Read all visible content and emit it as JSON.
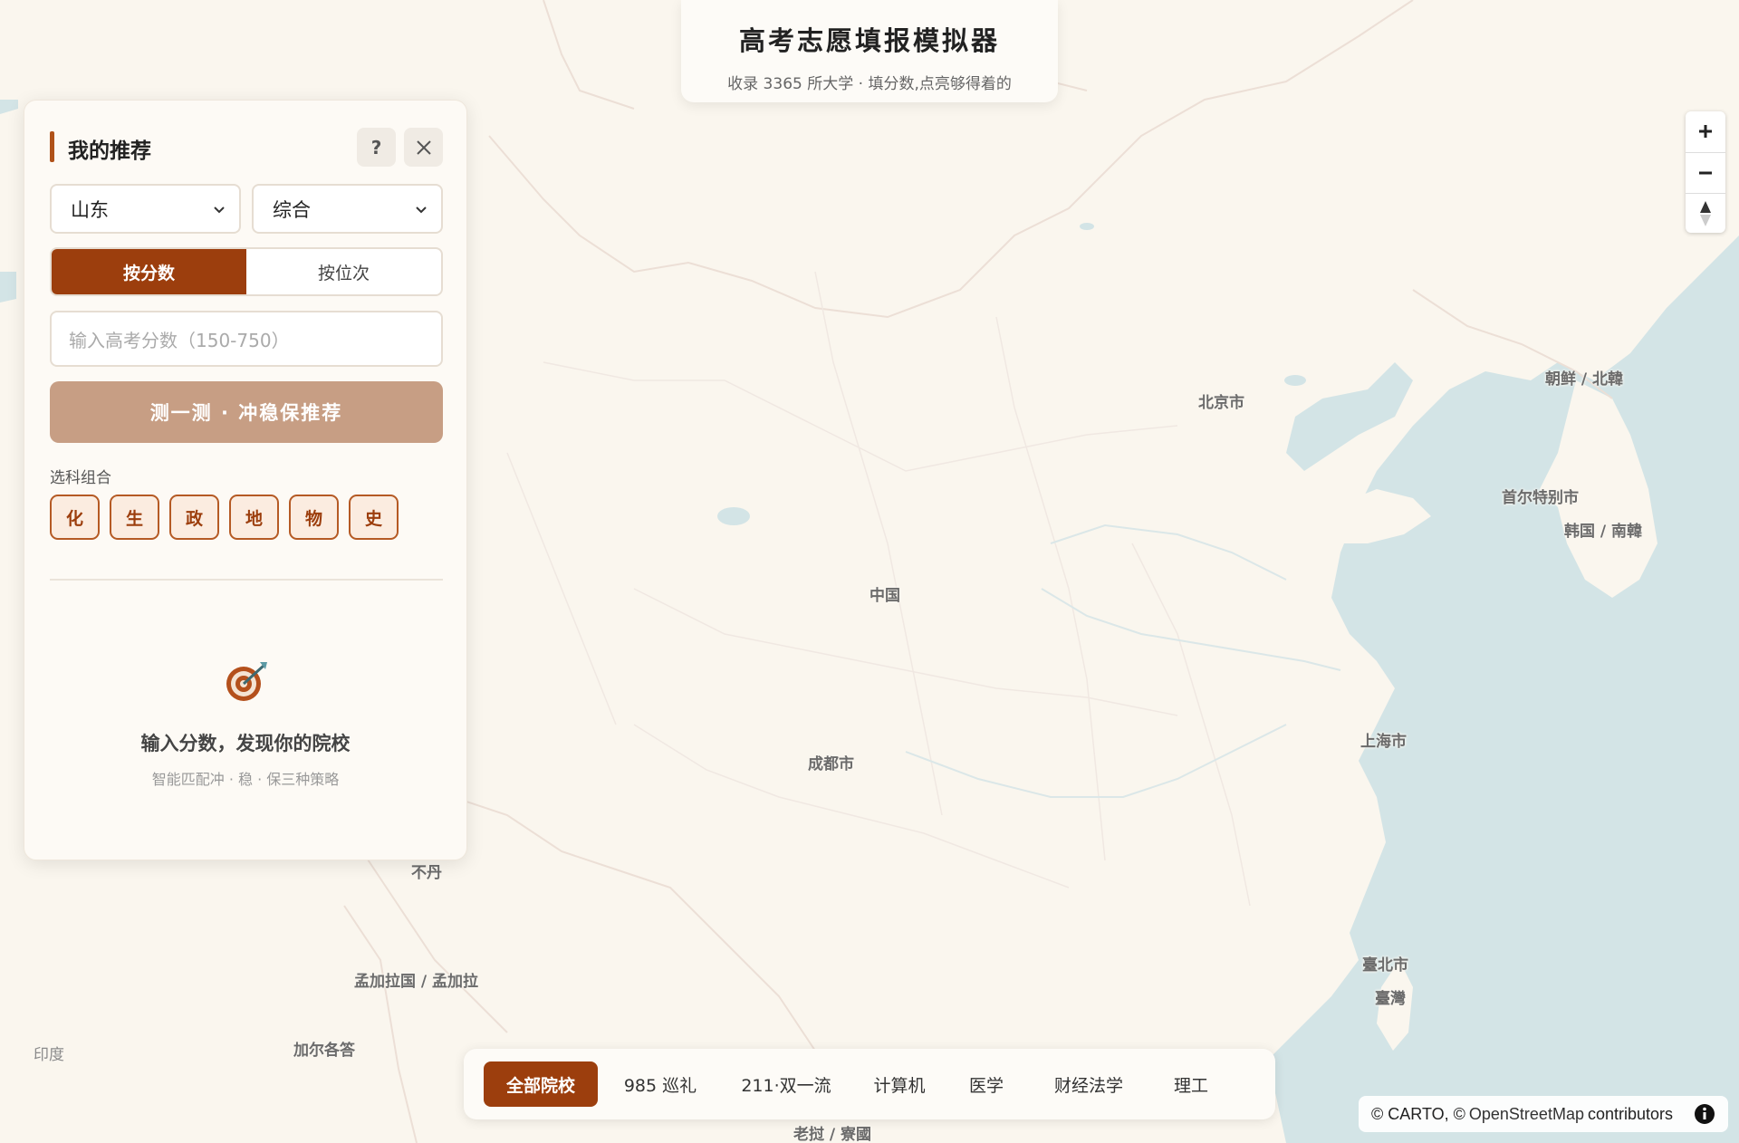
{
  "header": {
    "title": "高考志愿填报模拟器",
    "subtitle": "收录 3365 所大学 · 填分数,点亮够得着的"
  },
  "panel": {
    "title": "我的推荐",
    "help_label": "?",
    "province": "山东",
    "stream": "综合",
    "mode_tabs": [
      {
        "label": "按分数",
        "active": true
      },
      {
        "label": "按位次",
        "active": false
      }
    ],
    "score_placeholder": "输入高考分数（150-750）",
    "submit_label": "测一测 · 冲稳保推荐",
    "subjects_label": "选科组合",
    "subjects": [
      "化",
      "生",
      "政",
      "地",
      "物",
      "史"
    ],
    "empty_title": "输入分数，发现你的院校",
    "empty_subtitle": "智能匹配冲 · 稳 · 保三种策略"
  },
  "map": {
    "labels": [
      "北京市",
      "朝鲜 / 北韓",
      "首尔特别市",
      "韩国 / 南韓",
      "中国",
      "成都市",
      "上海市",
      "臺北市",
      "臺灣",
      "不丹",
      "孟加拉国 / 孟加拉",
      "加尔各答",
      "印度",
      "老挝 / 寮國"
    ]
  },
  "filters": [
    {
      "label": "全部院校",
      "active": true
    },
    {
      "label": "985 巡礼",
      "active": false
    },
    {
      "label": "211·双一流",
      "active": false
    },
    {
      "label": "计算机",
      "active": false
    },
    {
      "label": "医学",
      "active": false
    },
    {
      "label": "财经法学",
      "active": false
    },
    {
      "label": "理工",
      "active": false
    }
  ],
  "attribution": {
    "prefix": "© CARTO, ©",
    "link": "OpenStreetMap",
    "suffix": "contributors"
  },
  "colors": {
    "accent": "#9c3e0d",
    "button_disabled": "#c79e84",
    "land": "#faf6ee",
    "water": "#d3e4e6"
  },
  "icons": [
    "close-icon",
    "chevron-down-icon",
    "target-icon",
    "zoom-in-icon",
    "zoom-out-icon",
    "compass-icon",
    "info-icon"
  ]
}
